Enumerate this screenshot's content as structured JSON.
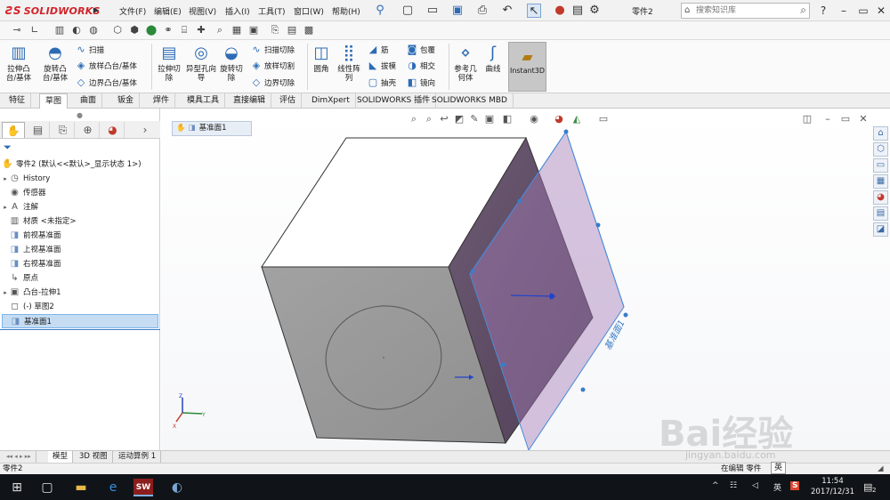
{
  "app": {
    "brand": "SOLIDWORKS",
    "document_name": "零件2",
    "search_placeholder": "搜索知识库"
  },
  "menu": [
    "文件(F)",
    "编辑(E)",
    "视图(V)",
    "插入(I)",
    "工具(T)",
    "窗口(W)",
    "帮助(H)"
  ],
  "features": {
    "extrude_boss": "拉伸凸台/基体",
    "revolve_boss": "旋转凸台/基体",
    "sweep": "扫描",
    "loft": "放样凸台/基体",
    "boundary_boss": "边界凸台/基体",
    "extrude_cut": "拉伸切除",
    "hole_wizard": "异型孔向导",
    "revolve_cut": "旋转切除",
    "swept_cut": "扫描切除",
    "lofted_cut": "放样切割",
    "boundary_cut": "边界切除",
    "fillet": "圆角",
    "linear_pattern": "线性阵列",
    "rib": "筋",
    "draft": "拔模",
    "shell": "抽壳",
    "wrap": "包覆",
    "intersect": "相交",
    "mirror": "镜向",
    "ref_geometry": "参考几何体",
    "curves": "曲线",
    "instant3d": "Instant3D"
  },
  "tabs": [
    "特征",
    "草图",
    "曲面",
    "钣金",
    "焊件",
    "模具工具",
    "直接编辑",
    "评估",
    "DimXpert",
    "SOLIDWORKS 插件",
    "SOLIDWORKS MBD"
  ],
  "tree": {
    "root": "零件2 (默认<<默认>_显示状态 1>)",
    "items": [
      {
        "label": "History",
        "icon": "history-icon",
        "expand": true
      },
      {
        "label": "传感器",
        "icon": "sensor-icon",
        "expand": false
      },
      {
        "label": "注解",
        "icon": "annotation-icon",
        "expand": true
      },
      {
        "label": "材质 <未指定>",
        "icon": "material-icon",
        "expand": false
      },
      {
        "label": "前视基准面",
        "icon": "plane-icon",
        "expand": false
      },
      {
        "label": "上视基准面",
        "icon": "plane-icon",
        "expand": false
      },
      {
        "label": "右视基准面",
        "icon": "plane-icon",
        "expand": false
      },
      {
        "label": "原点",
        "icon": "origin-icon",
        "expand": false
      },
      {
        "label": "凸台-拉伸1",
        "icon": "extrude-icon",
        "expand": true
      },
      {
        "label": "(-) 草图2",
        "icon": "sketch-icon",
        "expand": false
      },
      {
        "label": "基准面1",
        "icon": "plane-icon",
        "expand": false
      }
    ]
  },
  "viewport": {
    "breadcrumb": "基准面1",
    "plane_label": "基准面1"
  },
  "bottom_tabs": [
    "模型",
    "3D 视图",
    "运动算例 1"
  ],
  "status": {
    "left": "零件2",
    "right": "在编辑 零件"
  },
  "taskbar": {
    "ime": "英",
    "time": "11:54",
    "date": "2017/12/31",
    "notification_count": "2"
  },
  "watermark": {
    "main": "Bai经验",
    "sub": "jingyan.baidu.com"
  },
  "colors": {
    "brand_red": "#d1232a",
    "selection_blue": "#3a7dc9",
    "plane_purple": "#8b5fa0"
  }
}
